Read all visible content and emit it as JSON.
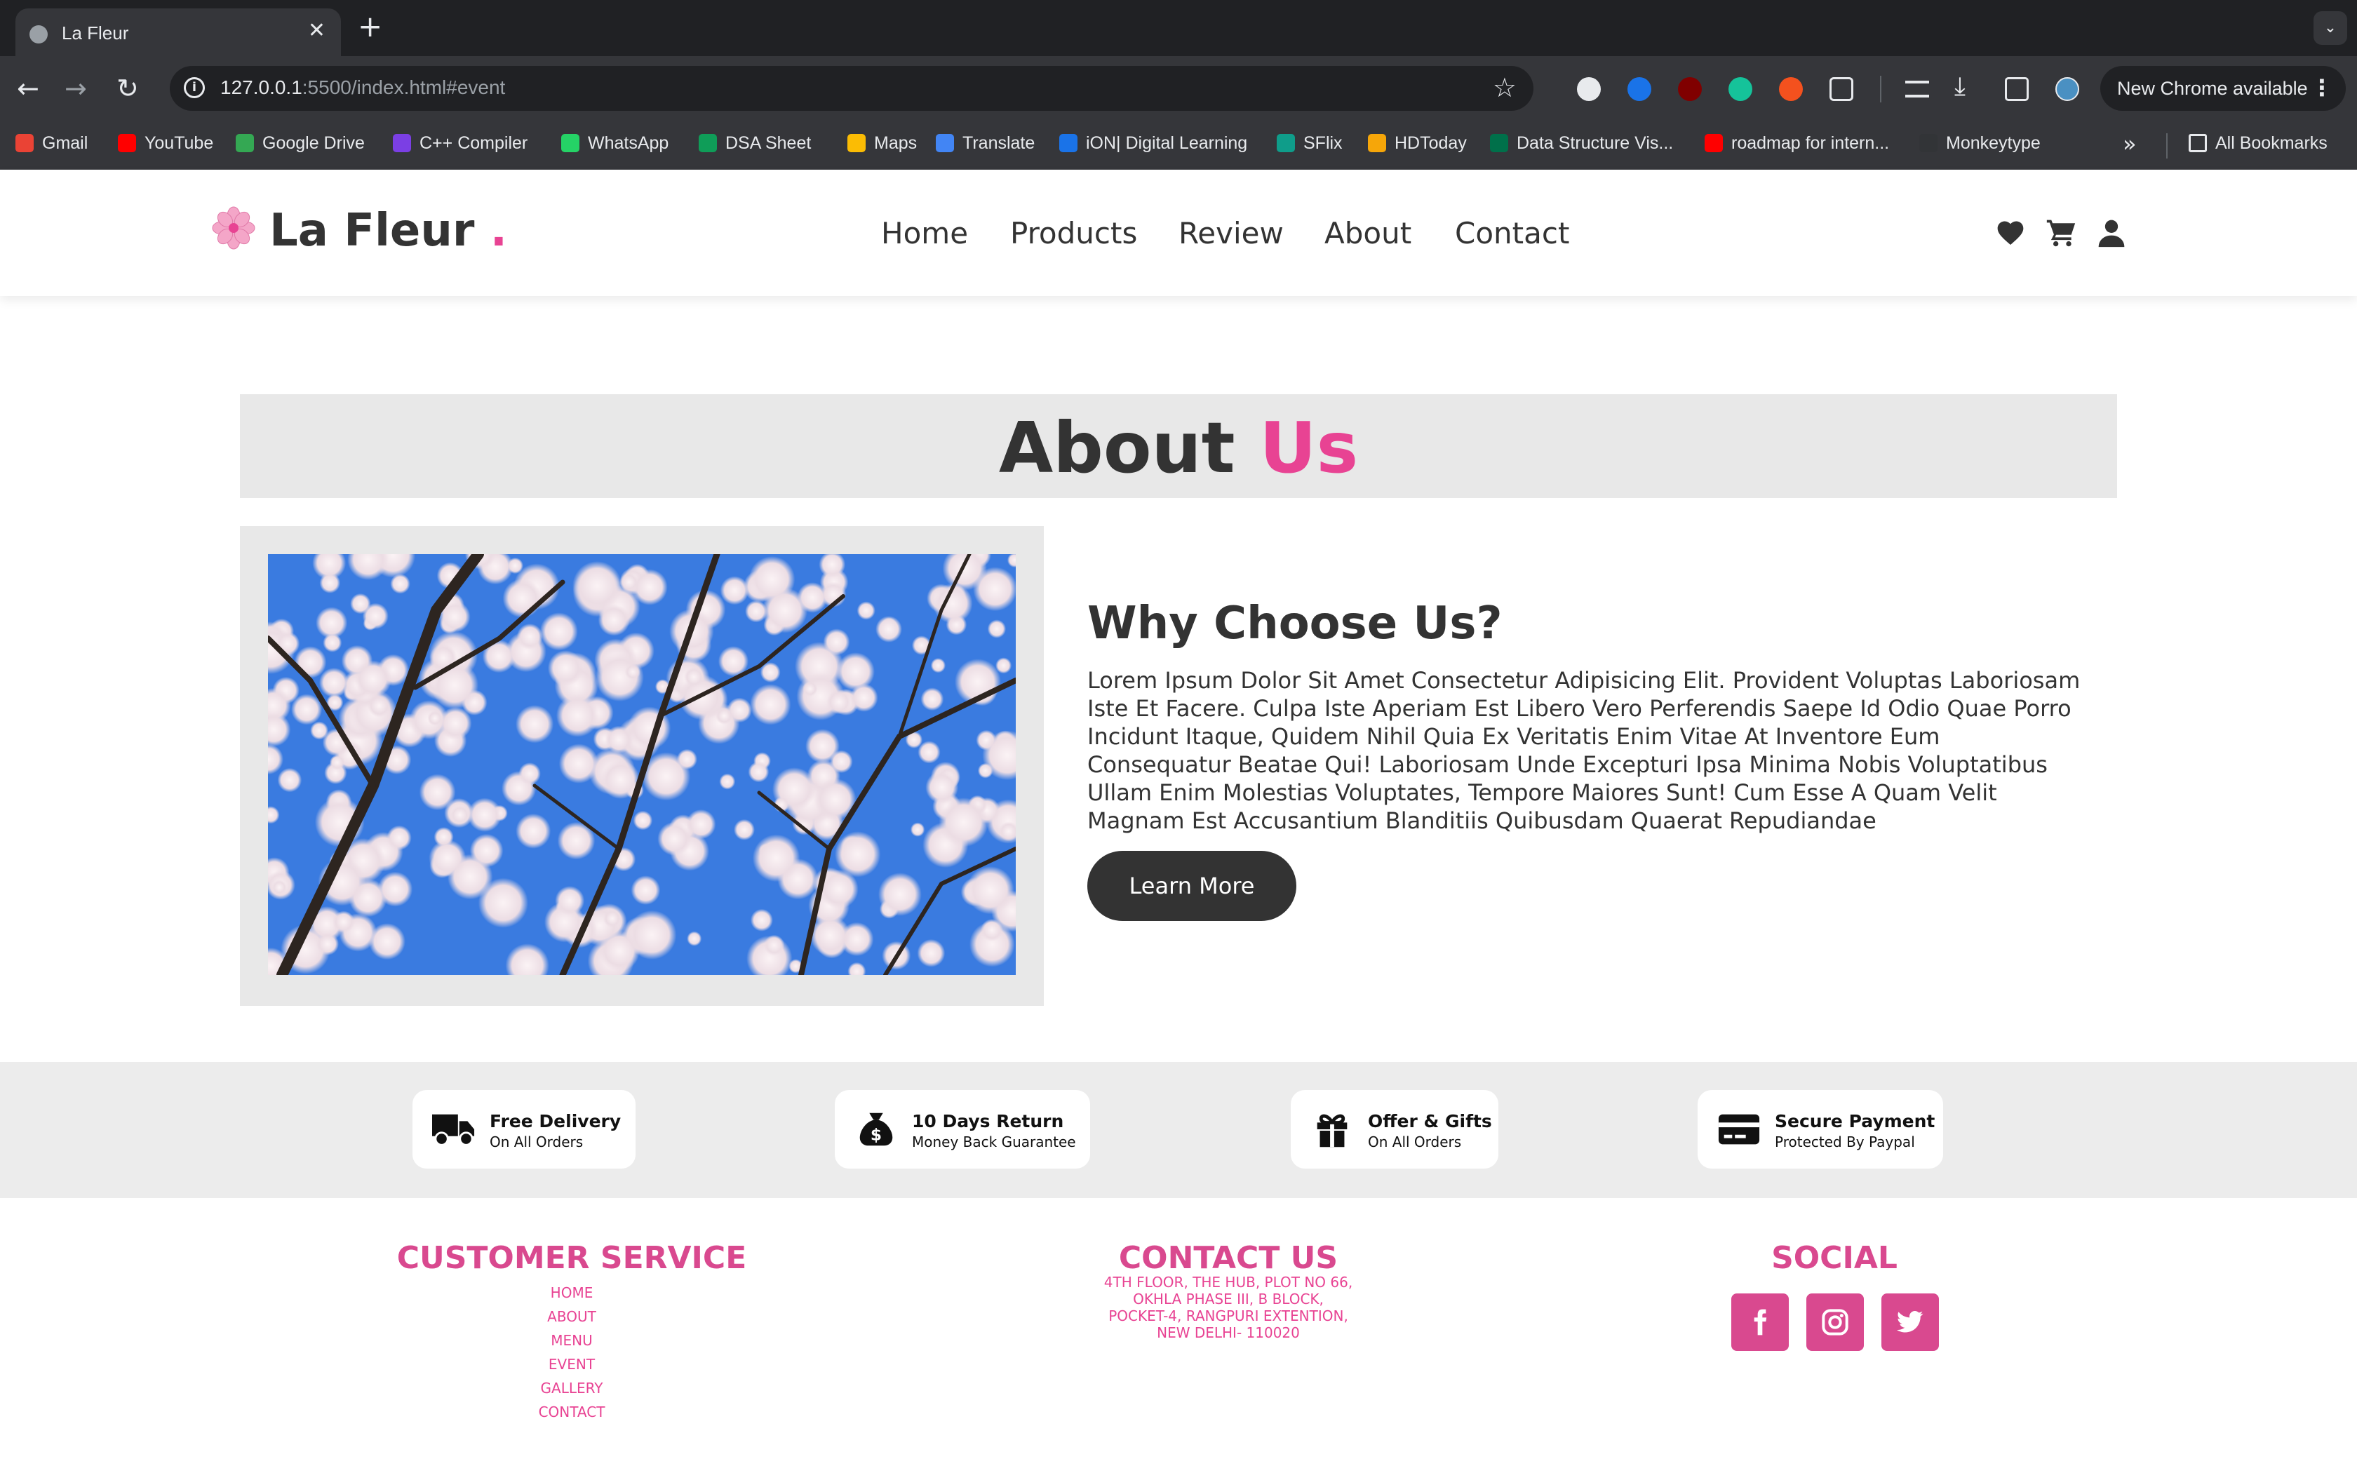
{
  "browser": {
    "tab_title": "La Fleur",
    "tab_close": "✕",
    "new_tab": "+",
    "url_host": "127.0.0.1",
    "url_rest": ":5500/index.html#event",
    "update_label": "New Chrome available",
    "bookmarks": [
      {
        "label": "Gmail",
        "icon": "gmail-icon",
        "color": "#ea4335"
      },
      {
        "label": "YouTube",
        "icon": "youtube-icon",
        "color": "#ff0000"
      },
      {
        "label": "Google Drive",
        "icon": "drive-icon",
        "color": "#34a853"
      },
      {
        "label": "C++ Compiler",
        "icon": "compiler-icon",
        "color": "#7b3fe4"
      },
      {
        "label": "WhatsApp",
        "icon": "whatsapp-icon",
        "color": "#25d366"
      },
      {
        "label": "DSA Sheet",
        "icon": "sheet-icon",
        "color": "#0f9d58"
      },
      {
        "label": "Maps",
        "icon": "maps-icon",
        "color": "#fbbc04"
      },
      {
        "label": "Translate",
        "icon": "translate-icon",
        "color": "#4285f4"
      },
      {
        "label": "iON| Digital Learning",
        "icon": "ion-icon",
        "color": "#1a73e8"
      },
      {
        "label": "SFlix",
        "icon": "sflix-icon",
        "color": "#0f9d8a"
      },
      {
        "label": "HDToday",
        "icon": "hdtoday-icon",
        "color": "#f6a609"
      },
      {
        "label": "Data Structure Vis...",
        "icon": "usf-icon",
        "color": "#00704a"
      },
      {
        "label": "roadmap for intern...",
        "icon": "youtube-icon",
        "color": "#ff0000"
      },
      {
        "label": "Monkeytype",
        "icon": "monkeytype-icon",
        "color": "#323437"
      }
    ],
    "all_bookmarks": "All Bookmarks"
  },
  "site": {
    "logo_text": "La Fleur",
    "logo_dot": ".",
    "nav": [
      "Home",
      "Products",
      "Review",
      "About",
      "Contact"
    ],
    "header_icons": [
      "heart-icon",
      "cart-icon",
      "user-icon"
    ],
    "brand_color": "#e84393",
    "dark_color": "#333333"
  },
  "about": {
    "heading_main": "About",
    "heading_accent": "Us",
    "image_alt": "cherry blossom tree against blue sky",
    "why_title": "Why Choose Us?",
    "why_text": "Lorem Ipsum Dolor Sit Amet Consectetur Adipisicing Elit. Provident Voluptas Laboriosam Iste Et Facere. Culpa Iste Aperiam Est Libero Vero Perferendis Saepe Id Odio Quae Porro Incidunt Itaque, Quidem Nihil Quia Ex Veritatis Enim Vitae At Inventore Eum Consequatur Beatae Qui! Laboriosam Unde Excepturi Ipsa Minima Nobis Voluptatibus Ullam Enim Molestias Voluptates, Tempore Maiores Sunt! Cum Esse A Quam Velit Magnam Est Accusantium Blanditiis Quibusdam Quaerat Repudiandae",
    "learn_more": "Learn More"
  },
  "features": [
    {
      "title": "Free Delivery",
      "sub": "On All Orders",
      "icon": "truck-icon"
    },
    {
      "title": "10 Days Return",
      "sub": "Money Back Guarantee",
      "icon": "money-bag-icon"
    },
    {
      "title": "Offer & Gifts",
      "sub": "On All Orders",
      "icon": "gift-icon"
    },
    {
      "title": "Secure Payment",
      "sub": "Protected By Paypal",
      "icon": "credit-card-icon"
    }
  ],
  "footer": {
    "customer_service": {
      "title": "CUSTOMER SERVICE",
      "links": [
        "HOME",
        "ABOUT",
        "MENU",
        "EVENT",
        "GALLERY",
        "CONTACT"
      ]
    },
    "contact": {
      "title": "CONTACT US",
      "address": [
        "4TH FLOOR, THE HUB, PLOT NO 66,",
        "OKHLA PHASE III, B BLOCK,",
        "POCKET-4, RANGPURI EXTENTION,",
        "NEW DELHI- 110020"
      ]
    },
    "social": {
      "title": "SOCIAL",
      "icons": [
        "facebook-icon",
        "instagram-icon",
        "twitter-icon"
      ]
    }
  }
}
